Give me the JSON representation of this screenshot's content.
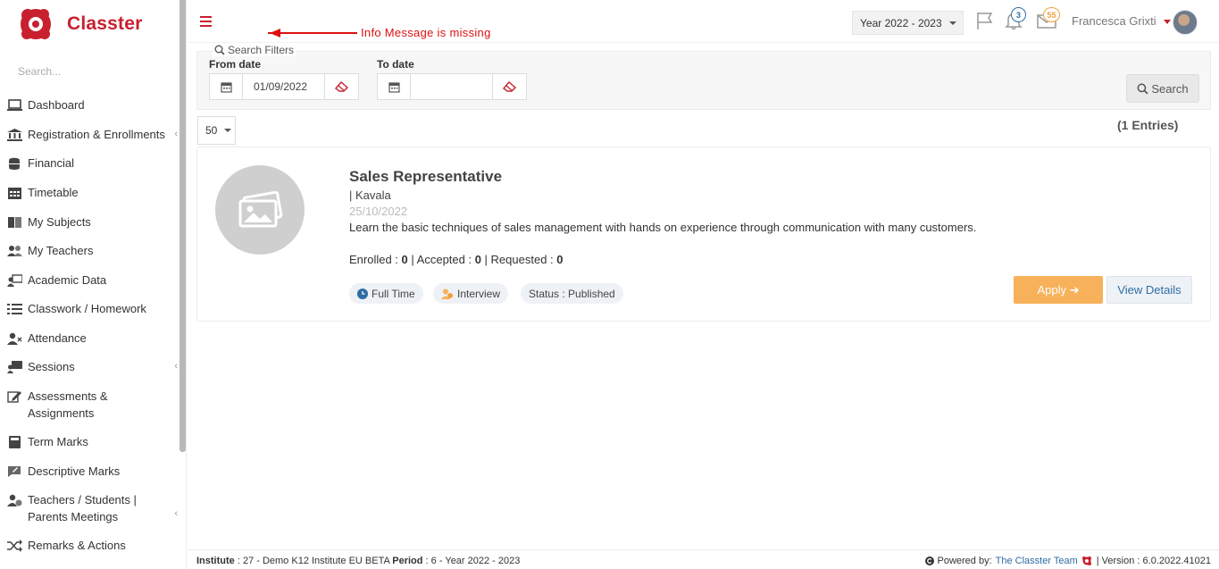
{
  "app": {
    "name": "Classter"
  },
  "sidebar": {
    "search_placeholder": "Search...",
    "items": [
      {
        "label": "Dashboard",
        "icon": "laptop-icon"
      },
      {
        "label": "Registration & Enrollments",
        "icon": "institution-icon"
      },
      {
        "label": "Financial",
        "icon": "coins-icon"
      },
      {
        "label": "Timetable",
        "icon": "calendar-icon"
      },
      {
        "label": "My Subjects",
        "icon": "book-icon"
      },
      {
        "label": "My Teachers",
        "icon": "users-icon"
      },
      {
        "label": "Academic Data",
        "icon": "teacher-board-icon"
      },
      {
        "label": "Classwork / Homework",
        "icon": "list-icon"
      },
      {
        "label": "Attendance",
        "icon": "user-x-icon"
      },
      {
        "label": "Sessions",
        "icon": "presentation-icon"
      },
      {
        "label": "Assessments & Assignments",
        "icon": "edit-icon"
      },
      {
        "label": "Term Marks",
        "icon": "calculator-icon"
      },
      {
        "label": "Descriptive Marks",
        "icon": "comment-edit-icon"
      },
      {
        "label": "Teachers / Students | Parents Meetings",
        "icon": "user-clock-icon"
      },
      {
        "label": "Remarks & Actions",
        "icon": "shuffle-icon"
      }
    ]
  },
  "topbar": {
    "annotation": "Info Message is missing",
    "year_selector": "Year 2022 - 2023",
    "notifications_count": "3",
    "messages_count": "55",
    "user_name": "Francesca Grixti"
  },
  "filters": {
    "legend": "Search Filters",
    "from_label": "From date",
    "from_value": "01/09/2022",
    "to_label": "To date",
    "to_value": "",
    "search_label": "Search"
  },
  "list": {
    "page_size": "50",
    "entries": "(1 Entries)"
  },
  "job": {
    "title": "Sales Representative",
    "location": "| Kavala",
    "date": "25/10/2022",
    "description": "Learn the basic techniques of sales management with hands on experience through communication with many customers.",
    "enrolled_label": "Enrolled : ",
    "enrolled": "0",
    "accepted_label": " | Accepted : ",
    "accepted": "0",
    "requested_label": " | Requested : ",
    "requested": "0",
    "tags": [
      "Full Time",
      "Interview",
      "Status : Published"
    ],
    "apply_label": "Apply ➔",
    "details_label": "View Details"
  },
  "footer": {
    "institute_label": "Institute",
    "institute_value": " : 27 - Demo K12 Institute EU BETA ",
    "period_label": "Period",
    "period_value": " : 6 - Year 2022 - 2023",
    "powered_label": "Powered by:",
    "powered_link": "The Classter Team",
    "version": "| Version : 6.0.2022.41021"
  },
  "colors": {
    "brand": "#c8202f",
    "accent": "#f7b15a",
    "link": "#2e6ca4"
  }
}
